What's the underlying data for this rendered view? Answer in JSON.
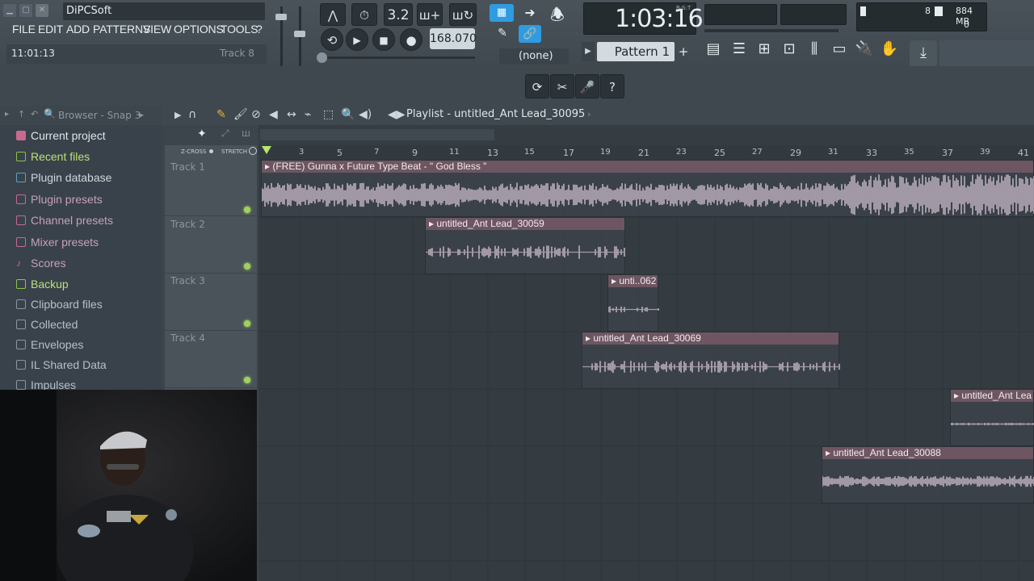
{
  "window": {
    "title": "DiPCSoft",
    "hint_time": "11:01:13",
    "hint_track": "Track 8"
  },
  "menu": [
    "FILE",
    "EDIT",
    "ADD",
    "PATTERNS",
    "VIEW",
    "OPTIONS",
    "TOOLS",
    "?"
  ],
  "transport": {
    "tempo": "168.070",
    "song_time": "1:03:16",
    "time_unit": "B:S:T",
    "pattern": "Pattern 1",
    "none_label": "(none)",
    "snap_value": "3.2"
  },
  "monitor": {
    "cpu": "8",
    "memory": "884 MB",
    "voices": "0"
  },
  "browser": {
    "header": "Browser - Snap 3",
    "items": [
      "Current project",
      "Recent files",
      "Plugin database",
      "Plugin presets",
      "Channel presets",
      "Mixer presets",
      "Scores",
      "Backup",
      "Clipboard files",
      "Collected",
      "Envelopes",
      "IL Shared Data",
      "Impulses"
    ]
  },
  "playlist": {
    "title": "Playlist - untitled_Ant Lead_30095",
    "zcross": "Z-CROSS",
    "stretch": "STRETCH",
    "ruler": [
      "3",
      "5",
      "7",
      "9",
      "11",
      "13",
      "15",
      "17",
      "19",
      "21",
      "23",
      "25",
      "27",
      "29",
      "31",
      "33",
      "35",
      "37",
      "39",
      "41"
    ],
    "tracks": [
      "Track 1",
      "Track 2",
      "Track 3",
      "Track 4"
    ],
    "clips": [
      {
        "name": "(FREE) Gunna x Future Type Beat -  \" God Bless \""
      },
      {
        "name": "untitled_Ant Lead_30059"
      },
      {
        "name": "unti..062"
      },
      {
        "name": "untitled_Ant Lead_30069"
      },
      {
        "name": "untitled_Ant Lea"
      },
      {
        "name": "untitled_Ant Lead_30088"
      }
    ]
  },
  "colors": {
    "clip_header": "#6d5661",
    "waveform": "#e6d3e3",
    "accent_blue": "#2f9be0",
    "led_green": "#9ed35a"
  }
}
